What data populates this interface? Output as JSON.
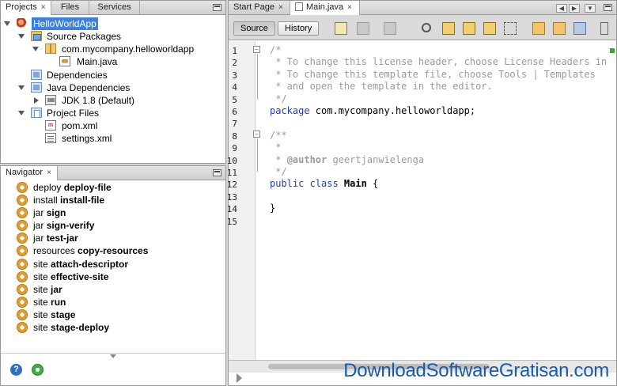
{
  "left_top": {
    "tabs": [
      {
        "label": "Projects",
        "close": "×"
      },
      {
        "label": "Files"
      },
      {
        "label": "Services"
      }
    ],
    "tree": [
      {
        "label": "HelloWorldApp"
      },
      {
        "label": "Source Packages"
      },
      {
        "label": "com.mycompany.helloworldapp"
      },
      {
        "label": "Main.java"
      },
      {
        "label": "Dependencies"
      },
      {
        "label": "Java Dependencies"
      },
      {
        "label": "JDK 1.8 (Default)"
      },
      {
        "label": "Project Files"
      },
      {
        "label": "pom.xml"
      },
      {
        "label": "settings.xml"
      }
    ]
  },
  "navigator": {
    "tab": {
      "label": "Navigator",
      "close": "×"
    },
    "items": [
      {
        "phase": "deploy",
        "goal": "deploy-file"
      },
      {
        "phase": "install",
        "goal": "install-file"
      },
      {
        "phase": "jar",
        "goal": "sign"
      },
      {
        "phase": "jar",
        "goal": "sign-verify"
      },
      {
        "phase": "jar",
        "goal": "test-jar"
      },
      {
        "phase": "resources",
        "goal": "copy-resources"
      },
      {
        "phase": "site",
        "goal": "attach-descriptor"
      },
      {
        "phase": "site",
        "goal": "effective-site"
      },
      {
        "phase": "site",
        "goal": "jar"
      },
      {
        "phase": "site",
        "goal": "run"
      },
      {
        "phase": "site",
        "goal": "stage"
      },
      {
        "phase": "site",
        "goal": "stage-deploy"
      }
    ],
    "bottom_icons": [
      "help-icon",
      "settings-icon"
    ]
  },
  "editor": {
    "tabs": [
      {
        "label": "Start Page",
        "close": "×"
      },
      {
        "label": "Main.java",
        "close": "×"
      }
    ],
    "toolbar": {
      "source_label": "Source",
      "history_label": "History"
    },
    "line_numbers": [
      "1",
      "2",
      "3",
      "4",
      "5",
      "6",
      "7",
      "8",
      "9",
      "10",
      "11",
      "12",
      "13",
      "14",
      "15"
    ],
    "code": {
      "l1": "/*",
      "l2": " * To change this license header, choose License Headers in",
      "l3": " * To change this template file, choose Tools | Templates",
      "l4": " * and open the template in the editor.",
      "l5": " */",
      "l6_kw": "package",
      "l6_rest": " com.mycompany.helloworldapp;",
      "l8": "/**",
      "l9": " *",
      "l10_pre": " * ",
      "l10_tag": "@author",
      "l10_rest": " geertjanwielenga",
      "l11": " */",
      "l12_kw": "public class",
      "l12_name": " Main",
      "l12_rest": " {",
      "l14": "}"
    }
  },
  "watermark": "DownloadSoftwareGratisan.com",
  "colors": {
    "selection": "#3d80d9",
    "keyword": "#1a3fbf",
    "comment": "#9a9a9a",
    "watermark": "#1a5aa8"
  }
}
